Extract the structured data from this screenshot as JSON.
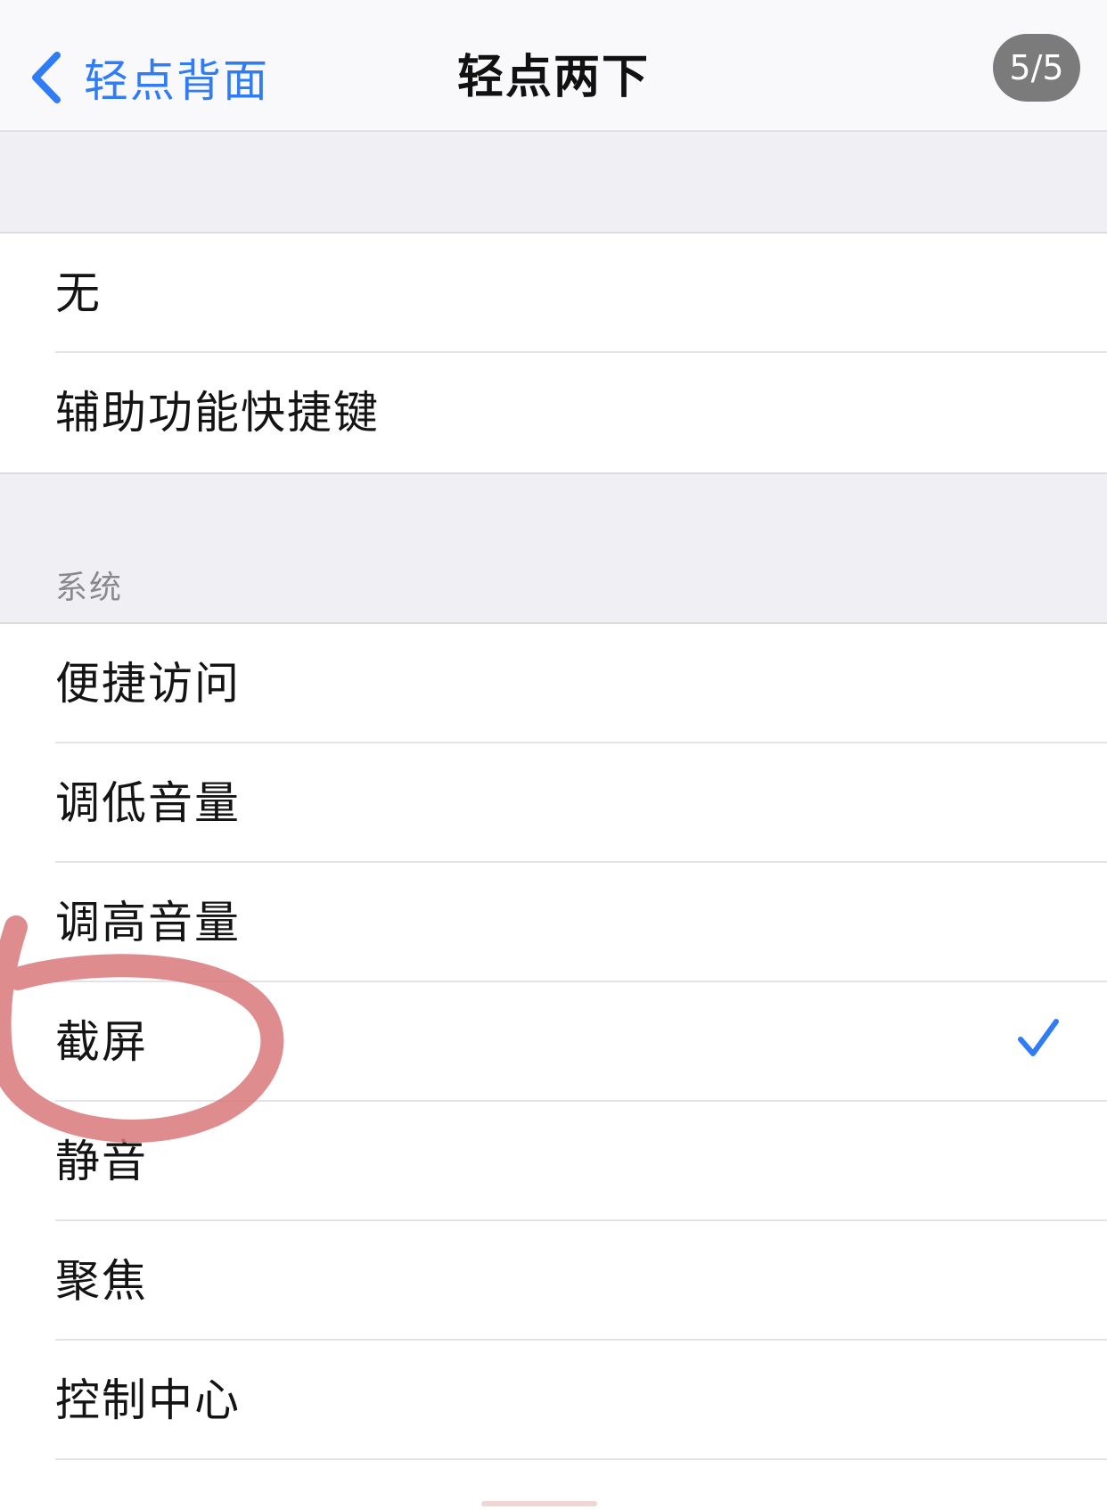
{
  "nav": {
    "back_label": "轻点背面",
    "title": "轻点两下",
    "page_counter": "5/5"
  },
  "group_top": {
    "items": [
      {
        "label": "无"
      },
      {
        "label": "辅助功能快捷键"
      }
    ]
  },
  "group_system": {
    "header": "系统",
    "items": [
      {
        "label": "便捷访问",
        "selected": false
      },
      {
        "label": "调低音量",
        "selected": false
      },
      {
        "label": "调高音量",
        "selected": false
      },
      {
        "label": "截屏",
        "selected": true
      },
      {
        "label": "静音",
        "selected": false
      },
      {
        "label": "聚焦",
        "selected": false
      },
      {
        "label": "控制中心",
        "selected": false
      }
    ]
  },
  "colors": {
    "accent": "#2f7cf6",
    "group_background": "#efeff4",
    "annotation_circle": "#d9787a"
  },
  "icons": {
    "back": "chevron-left-icon",
    "selected": "checkmark-icon"
  }
}
